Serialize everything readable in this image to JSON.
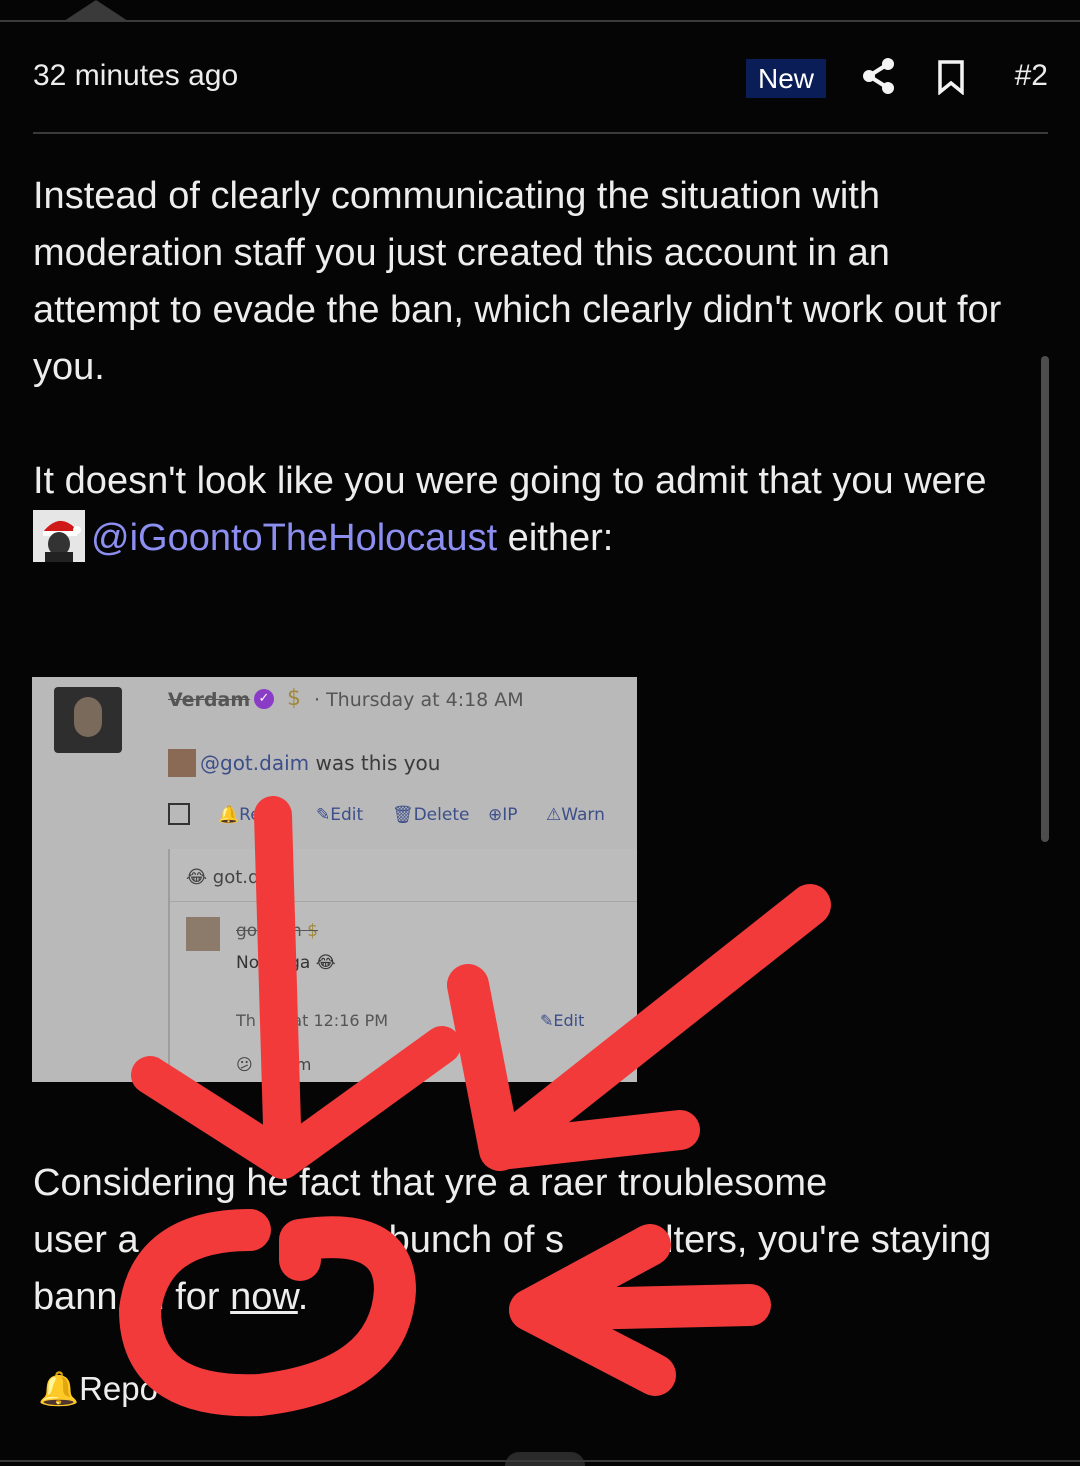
{
  "post": {
    "time": "32 minutes ago",
    "badge": "New",
    "number": "#2",
    "paragraph1": "Instead of clearly communicating the situation with moderation staff you just created this account in an attempt to evade the ban, which clearly didn't work out for you.",
    "paragraph2_prefix": "It doesn't look like you were going to admit that you were",
    "mention": "@iGoontoTheHolocaust",
    "paragraph2_suffix": " either:",
    "paragraph3_a": "Considering ",
    "paragraph3_b": "he fact that y",
    "paragraph3_c": "re a ra",
    "paragraph3_d": "er troublesome",
    "paragraph3_line2_a": "user a",
    "paragraph3_line2_b": "bunch of s",
    "paragraph3_line2_c": "alters, you're staying",
    "paragraph3_line3_a": "bann",
    "paragraph3_line3_b": "d for ",
    "paragraph3_line3_link": "now",
    "paragraph3_line3_end": ".",
    "report": "Repo"
  },
  "screenshot": {
    "username": "Verdam",
    "timestamp": "· Thursday at 4:18 AM",
    "mention": "@got.daim",
    "message": " was this you",
    "actions": [
      "Re",
      "Edit",
      "Delete",
      "IP",
      "Warn"
    ],
    "quote_header": "got.d",
    "quote_name": "go",
    "quote_name_end": "m",
    "quote_text_a": "No",
    "quote_text_b": "ga",
    "quote_time_a": "Th",
    "quote_time_b": "ay at 12:16 PM",
    "quote_action": "rt",
    "quote_edit": "Edit",
    "quote_footer": "dam"
  },
  "icons": [
    "share-icon",
    "bookmark-icon",
    "bell-icon",
    "avatar"
  ],
  "colors": {
    "accent": "#8c8ff0",
    "badge_bg": "#0a1d57",
    "annotation": "#f23a3a"
  }
}
